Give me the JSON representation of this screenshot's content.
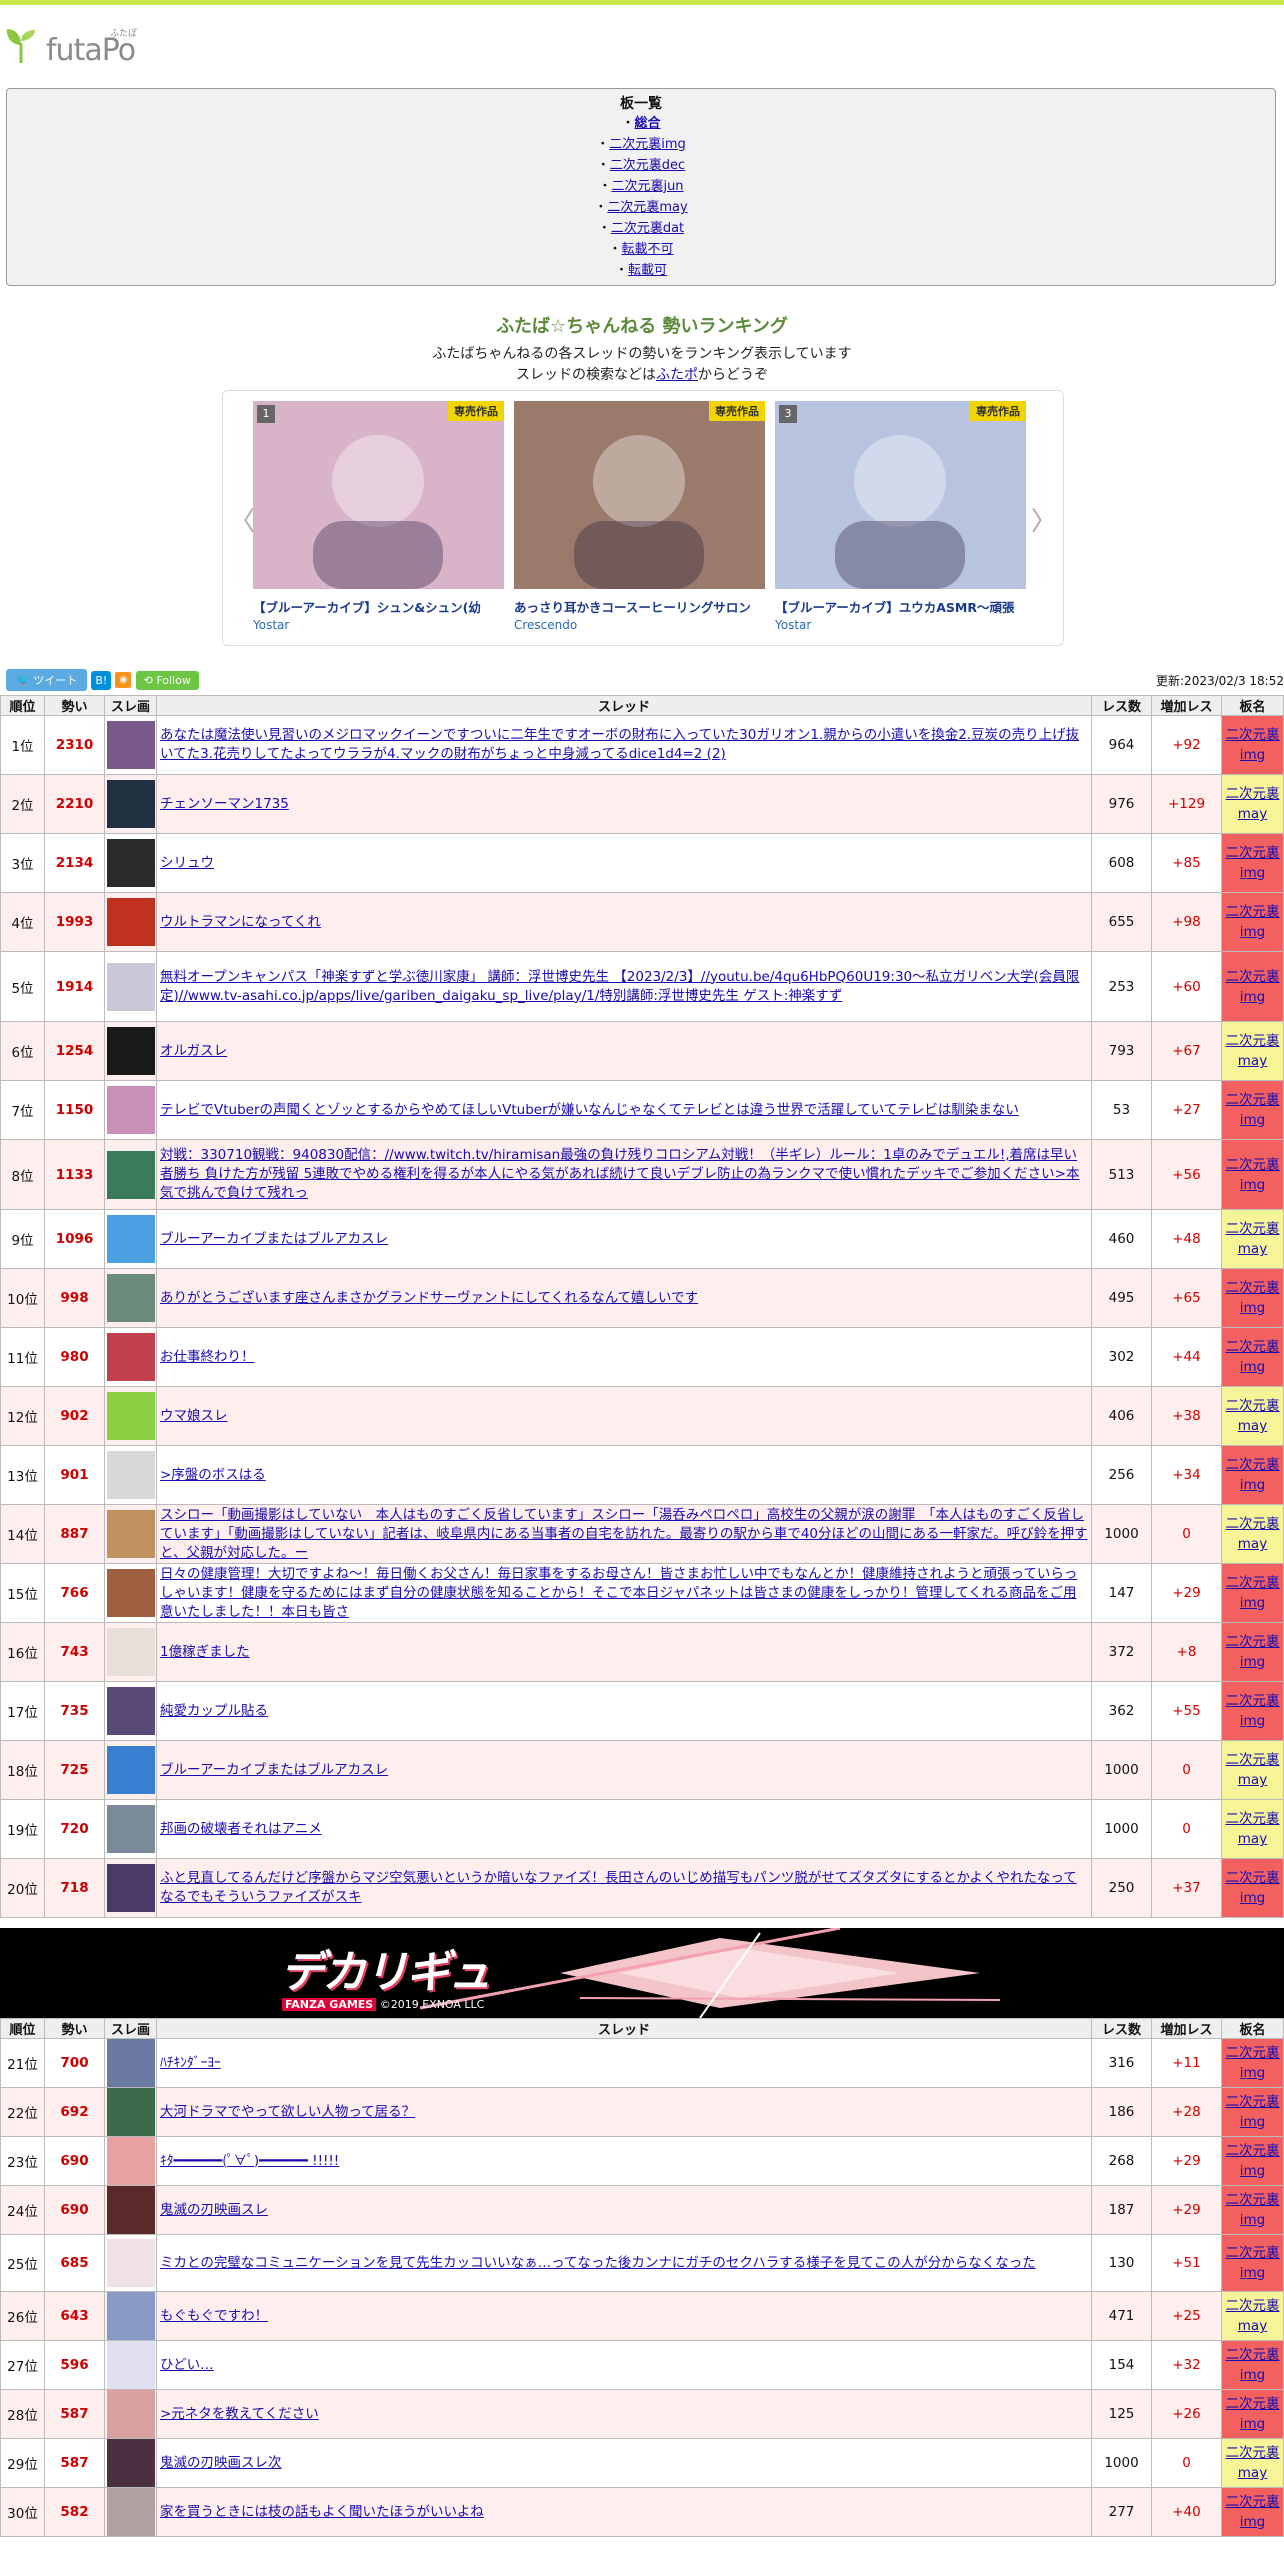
{
  "logo": {
    "word": "futaPo",
    "kana": "ふたぽ"
  },
  "board_list": {
    "title": "板一覧",
    "items": [
      {
        "bullet": "・",
        "label": "総合",
        "bold": true
      },
      {
        "bullet": "・",
        "label": "二次元裏img"
      },
      {
        "bullet": "・",
        "label": "二次元裏dec"
      },
      {
        "bullet": "・",
        "label": "二次元裏jun"
      },
      {
        "bullet": "・",
        "label": "二次元裏may"
      },
      {
        "bullet": "・",
        "label": "二次元裏dat"
      },
      {
        "bullet": "・",
        "label": "転載不可"
      },
      {
        "bullet": "・",
        "label": "転載可"
      }
    ]
  },
  "heading": {
    "title": "ふたば☆ちゃんねる 勢いランキング",
    "sub1": "ふたばちゃんねるの各スレッドの勢いをランキング表示しています",
    "sub2_pre": "スレッドの検索などは",
    "sub2_link": "ふたポ",
    "sub2_post": "からどうぞ"
  },
  "carousel": {
    "arrow_left": "〈",
    "arrow_right": "〉",
    "cards": [
      {
        "num": "1",
        "badge": "専売作品",
        "title": "【ブルーアーカイブ】シュン&シュン(幼",
        "maker": "Yostar",
        "bg": "#d9b4c9"
      },
      {
        "num": "",
        "badge": "専売作品",
        "title": "あっさり耳かきコースーヒーリングサロン",
        "maker": "Crescendo",
        "bg": "#9a7b6b"
      },
      {
        "num": "3",
        "badge": "専売作品",
        "title": "【ブルーアーカイブ】ユウカASMR～頑張",
        "maker": "Yostar",
        "bg": "#b8c3e0"
      }
    ]
  },
  "social": {
    "tweet": "ツイート",
    "hatena": "B!",
    "rss": "RSS",
    "follow": "Follow"
  },
  "updated": "更新:2023/02/3 18:52",
  "table_headers": [
    "順位",
    "勢い",
    "スレ画",
    "スレッド",
    "レス数",
    "増加レス",
    "板名"
  ],
  "rows1": [
    {
      "rank": "1位",
      "ikioi": "2310",
      "title": "あなたは魔法使い見習いのメジロマックイーンですついに二年生ですオーボの財布に入っていた30ガリオン1.親からの小遣いを換金2.豆炭の売り上げ抜いてた3.花売りしてたよってウララが4.マックの財布がちょっと中身減ってるdice1d4=2 (2)",
      "res": "964",
      "inc": "+92",
      "b1": "二次元裏",
      "b2": "img",
      "thumb": "#7a5a8a"
    },
    {
      "rank": "2位",
      "ikioi": "2210",
      "title": "チェンソーマン1735",
      "res": "976",
      "inc": "+129",
      "b1": "二次元裏",
      "b2": "may",
      "thumb": "#203040"
    },
    {
      "rank": "3位",
      "ikioi": "2134",
      "title": "シリュウ",
      "res": "608",
      "inc": "+85",
      "b1": "二次元裏",
      "b2": "img",
      "thumb": "#2a2a2a"
    },
    {
      "rank": "4位",
      "ikioi": "1993",
      "title": "ウルトラマンになってくれ",
      "res": "655",
      "inc": "+98",
      "b1": "二次元裏",
      "b2": "img",
      "thumb": "#c03020"
    },
    {
      "rank": "5位",
      "ikioi": "1914",
      "title": "無料オープンキャンパス「神楽すずと学ぶ徳川家康」 講師：浮世博史先生 【2023/2/3】//youtu.be/4qu6HbPQ60U19:30～私立ガリベン大学(会員限定)//www.tv-asahi.co.jp/apps/live/gariben_daigaku_sp_live/play/1/特別講師:浮世博史先生 ゲスト:神楽すず",
      "res": "253",
      "inc": "+60",
      "b1": "二次元裏",
      "b2": "img",
      "thumb": "#c8c8d8"
    },
    {
      "rank": "6位",
      "ikioi": "1254",
      "title": "オルガスレ",
      "res": "793",
      "inc": "+67",
      "b1": "二次元裏",
      "b2": "may",
      "thumb": "#1a1a1a"
    },
    {
      "rank": "7位",
      "ikioi": "1150",
      "title": "テレビでVtuberの声聞くとゾッとするからやめてほしいVtuberが嫌いなんじゃなくてテレビとは違う世界で活躍していてテレビは馴染まない",
      "res": "53",
      "inc": "+27",
      "b1": "二次元裏",
      "b2": "img",
      "thumb": "#c890b8"
    },
    {
      "rank": "8位",
      "ikioi": "1133",
      "title": "対戦：330710観戦：940830配信：//www.twitch.tv/hiramisan最強の負け残りコロシアム対戦！（半ギレ）ルール：1卓のみでデュエル!,着席は早い者勝ち 負けた方が残留 5連敗でやめる権利を得るが本人にやる気があれば続けて良いデブレ防止の為ランクマで使い慣れたデッキでご参加ください>本気で挑んで負けて残れっ",
      "res": "513",
      "inc": "+56",
      "b1": "二次元裏",
      "b2": "img",
      "thumb": "#3a7a5a"
    },
    {
      "rank": "9位",
      "ikioi": "1096",
      "title": "ブルーアーカイブまたはブルアカスレ",
      "res": "460",
      "inc": "+48",
      "b1": "二次元裏",
      "b2": "may",
      "thumb": "#4aa0e0"
    },
    {
      "rank": "10位",
      "ikioi": "998",
      "title": "ありがとうございます座さんまさかグランドサーヴァントにしてくれるなんて嬉しいです",
      "res": "495",
      "inc": "+65",
      "b1": "二次元裏",
      "b2": "img",
      "thumb": "#6a8a7a"
    },
    {
      "rank": "11位",
      "ikioi": "980",
      "title": "お仕事終わり！",
      "res": "302",
      "inc": "+44",
      "b1": "二次元裏",
      "b2": "img",
      "thumb": "#c04050"
    },
    {
      "rank": "12位",
      "ikioi": "902",
      "title": "ウマ娘スレ",
      "res": "406",
      "inc": "+38",
      "b1": "二次元裏",
      "b2": "may",
      "thumb": "#8ad040"
    },
    {
      "rank": "13位",
      "ikioi": "901",
      "title": ">序盤のボスはる",
      "res": "256",
      "inc": "+34",
      "b1": "二次元裏",
      "b2": "img",
      "thumb": "#d8d8d8"
    },
    {
      "rank": "14位",
      "ikioi": "887",
      "title": "スシロー「動画撮影はしていない　本人はものすごく反省しています」スシロー「湯呑みペロペロ」高校生の父親が涙の謝罪　「本人はものすごく反省しています」「動画撮影はしていない」記者は、岐阜県内にある当事者の自宅を訪れた。最寄りの駅から車で40分ほどの山間にある一軒家だ。呼び鈴を押すと、父親が対応した。ー",
      "res": "1000",
      "inc": "0",
      "b1": "二次元裏",
      "b2": "may",
      "thumb": "#c09060"
    },
    {
      "rank": "15位",
      "ikioi": "766",
      "title": "日々の健康管理！大切ですよね～！毎日働くお父さん！毎日家事をするお母さん！皆さまお忙しい中でもなんとか！健康維持されようと頑張っていらっしゃいます！健康を守るためにはまず自分の健康状態を知ることから！そこで本日ジャパネットは皆さまの健康をしっかり！管理してくれる商品をご用意いたしました！！本日も皆さ",
      "res": "147",
      "inc": "+29",
      "b1": "二次元裏",
      "b2": "img",
      "thumb": "#a06040"
    },
    {
      "rank": "16位",
      "ikioi": "743",
      "title": "1億稼ぎました",
      "res": "372",
      "inc": "+8",
      "b1": "二次元裏",
      "b2": "img",
      "thumb": "#e8e0d8"
    },
    {
      "rank": "17位",
      "ikioi": "735",
      "title": "純愛カップル貼る",
      "res": "362",
      "inc": "+55",
      "b1": "二次元裏",
      "b2": "img",
      "thumb": "#5a4a7a"
    },
    {
      "rank": "18位",
      "ikioi": "725",
      "title": "ブルーアーカイブまたはブルアカスレ",
      "res": "1000",
      "inc": "0",
      "b1": "二次元裏",
      "b2": "may",
      "thumb": "#3a80d0"
    },
    {
      "rank": "19位",
      "ikioi": "720",
      "title": "邦画の破壊者それはアニメ",
      "res": "1000",
      "inc": "0",
      "b1": "二次元裏",
      "b2": "may",
      "thumb": "#7a8a9a"
    },
    {
      "rank": "20位",
      "ikioi": "718",
      "title": "ふと見直してるんだけど序盤からマジ空気悪いというか暗いなファイズ！長田さんのいじめ描写もパンツ脱がせてズタズタにするとかよくやれたなってなるでもそういうファイズがスキ",
      "res": "250",
      "inc": "+37",
      "b1": "二次元裏",
      "b2": "img",
      "thumb": "#4a3a6a"
    }
  ],
  "banner": {
    "logo": "デカリギュ",
    "maker": "FANZA GAMES",
    "copy": "©2019 EXNOA LLC"
  },
  "rows2": [
    {
      "rank": "21位",
      "ikioi": "700",
      "title": "ﾊﾁｷﾝﾀﾞｰﾖｰ",
      "res": "316",
      "inc": "+11",
      "b1": "二次元裏",
      "b2": "img",
      "thumb": "#6a7aa0"
    },
    {
      "rank": "22位",
      "ikioi": "692",
      "title": "大河ドラマでやって欲しい人物って居る？",
      "res": "186",
      "inc": "+28",
      "b1": "二次元裏",
      "b2": "img",
      "thumb": "#3a6a4a"
    },
    {
      "rank": "23位",
      "ikioi": "690",
      "title": "ｷﾀ━━━━━━(ﾟ∀ﾟ)━━━━━━ !!!!!",
      "res": "268",
      "inc": "+29",
      "b1": "二次元裏",
      "b2": "img",
      "thumb": "#e8a0a0"
    },
    {
      "rank": "24位",
      "ikioi": "690",
      "title": "鬼滅の刃映画スレ",
      "res": "187",
      "inc": "+29",
      "b1": "二次元裏",
      "b2": "img",
      "thumb": "#5a2a2a"
    },
    {
      "rank": "25位",
      "ikioi": "685",
      "title": "ミカとの完璧なコミュニケーションを見て先生カッコいいなぁ…ってなった後カンナにガチのセクハラする様子を見てこの人が分からなくなった",
      "res": "130",
      "inc": "+51",
      "b1": "二次元裏",
      "b2": "img",
      "thumb": "#f0e0e8"
    },
    {
      "rank": "26位",
      "ikioi": "643",
      "title": "もぐもぐですわ！",
      "res": "471",
      "inc": "+25",
      "b1": "二次元裏",
      "b2": "may",
      "thumb": "#8a9ac8"
    },
    {
      "rank": "27位",
      "ikioi": "596",
      "title": "ひどい…",
      "res": "154",
      "inc": "+32",
      "b1": "二次元裏",
      "b2": "img",
      "thumb": "#e0e0f0"
    },
    {
      "rank": "28位",
      "ikioi": "587",
      "title": ">元ネタを教えてください",
      "res": "125",
      "inc": "+26",
      "b1": "二次元裏",
      "b2": "img",
      "thumb": "#d8a0a0"
    },
    {
      "rank": "29位",
      "ikioi": "587",
      "title": "鬼滅の刃映画スレ次",
      "res": "1000",
      "inc": "0",
      "b1": "二次元裏",
      "b2": "may",
      "thumb": "#4a3040"
    },
    {
      "rank": "30位",
      "ikioi": "582",
      "title": "家を買うときには枝の話もよく聞いたほうがいいよね",
      "res": "277",
      "inc": "+40",
      "b1": "二次元裏",
      "b2": "img",
      "thumb": "#b0a0a0"
    }
  ]
}
